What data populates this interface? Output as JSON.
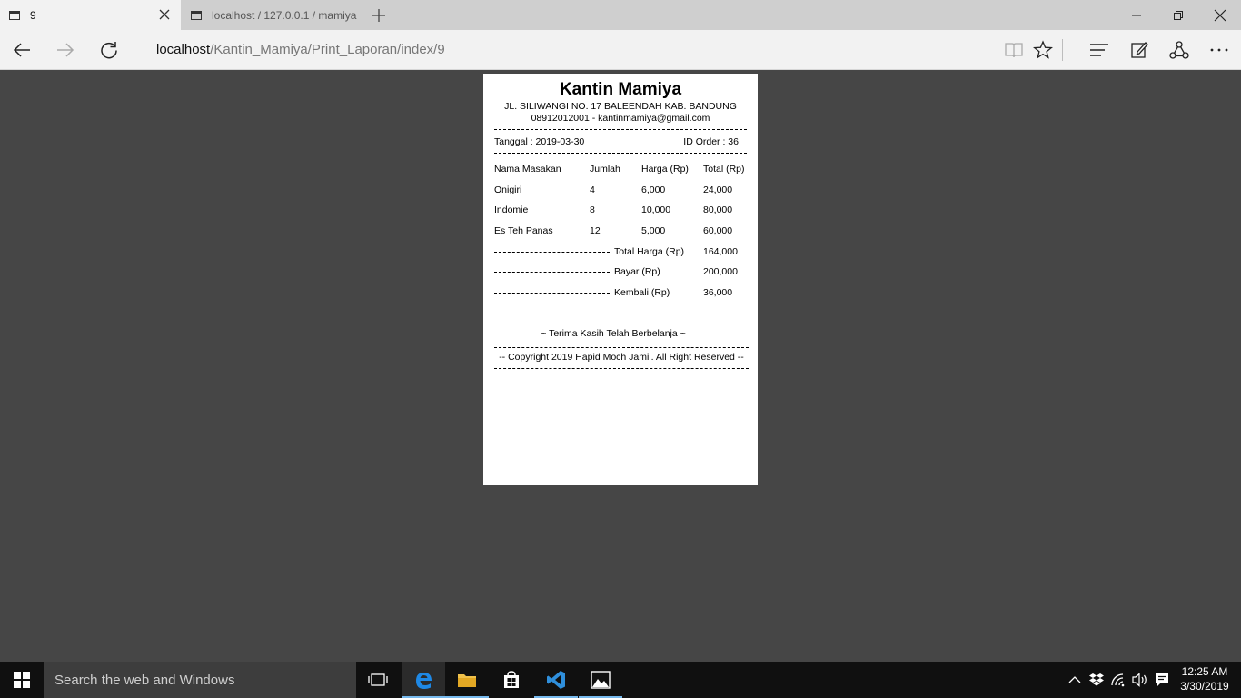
{
  "browser": {
    "tabs": [
      {
        "title": "9"
      },
      {
        "title": "localhost / 127.0.0.1 / mamiya"
      }
    ],
    "address": {
      "host": "localhost",
      "path": "/Kantin_Mamiya/Print_Laporan/index/9"
    }
  },
  "receipt": {
    "shop_name": "Kantin Mamiya",
    "address": "JL. SILIWANGI NO. 17 BALEENDAH KAB. BANDUNG",
    "contact": "08912012001 - kantinmamiya@gmail.com",
    "date_text": "Tanggal : 2019-03-30",
    "order_text": "ID Order : 36",
    "headers": [
      "Nama Masakan",
      "Jumlah",
      "Harga (Rp)",
      "Total (Rp)"
    ],
    "items": [
      {
        "name": "Onigiri",
        "qty": "4",
        "price": "6,000",
        "total": "24,000"
      },
      {
        "name": "Indomie",
        "qty": "8",
        "price": "10,000",
        "total": "80,000"
      },
      {
        "name": "Es Teh Panas",
        "qty": "12",
        "price": "5,000",
        "total": "60,000"
      }
    ],
    "summary": [
      {
        "label": "Total Harga (Rp)",
        "value": "164,000"
      },
      {
        "label": "Bayar (Rp)",
        "value": "200,000"
      },
      {
        "label": "Kembali (Rp)",
        "value": "36,000"
      }
    ],
    "thanks": "~ Terima Kasih Telah Berbelanja ~",
    "copyright": "--  Copyright 2019 Hapid Moch Jamil. All Right Reserved  --"
  },
  "taskbar": {
    "search_placeholder": "Search the web and Windows",
    "time": "12:25 AM",
    "date": "3/30/2019"
  }
}
